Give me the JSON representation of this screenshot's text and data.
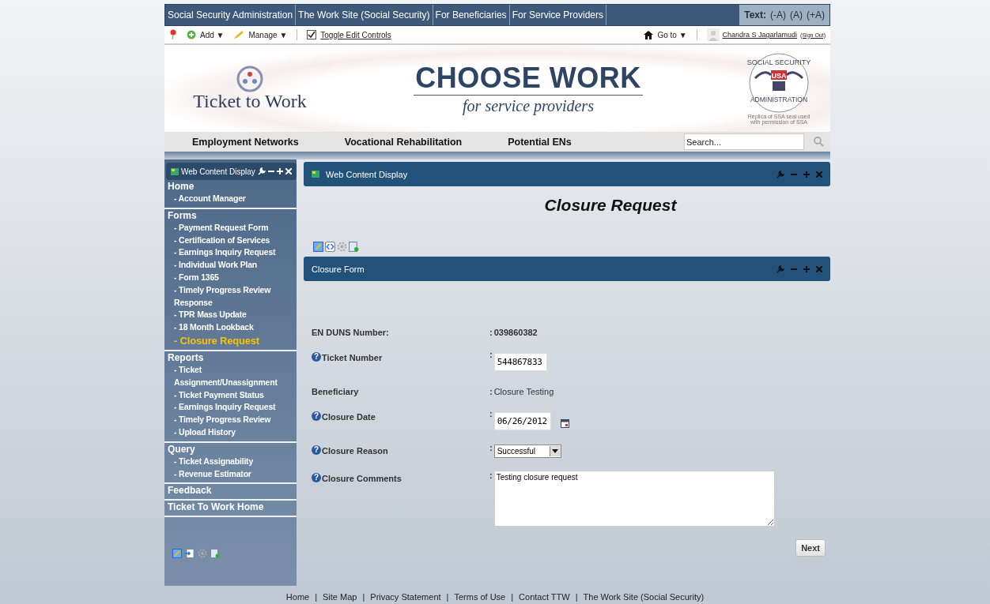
{
  "top_nav": {
    "links": [
      "Social Security Administration",
      "The Work Site (Social Security)",
      "For Beneficiaries",
      "For Service Providers"
    ],
    "text_size_label": "Text:",
    "text_sizes": [
      "(-A)",
      "(A)",
      "(+A)"
    ]
  },
  "toolbar": {
    "add": "Add",
    "add_caret": "▼",
    "manage": "Manage",
    "manage_caret": "▼",
    "goto_caret": "▼",
    "toggle": {
      "label": "Toggle Edit Controls",
      "checked": true
    },
    "goto": "Go to",
    "user": "Chandra S Jagarlamudi",
    "sign_out": "(Sign Out)"
  },
  "banner": {
    "logo_text": "Ticket to Work",
    "title": "CHOOSE WORK",
    "subtitle": "for service providers",
    "seal_top": "SOCIAL SECURITY",
    "seal_center": "USA",
    "seal_bottom": "ADMINISTRATION",
    "seal_caption": "Replica of SSA seal used with permission of SSA"
  },
  "main_nav": {
    "items": [
      "Employment Networks",
      "Vocational Rehabilitation",
      "Potential ENs"
    ],
    "search": {
      "placeholder": "Search..."
    }
  },
  "sidebar": {
    "portlet_title": "Web Content Display",
    "sections": [
      {
        "title": "Home",
        "items": [
          {
            "label": "- Account Manager",
            "selected": false
          }
        ]
      },
      {
        "title": "Forms",
        "items": [
          {
            "label": "- Payment Request Form",
            "selected": false
          },
          {
            "label": "- Certification of Services",
            "selected": false
          },
          {
            "label": "- Earnings Inquiry Request",
            "selected": false
          },
          {
            "label": "- Individual Work Plan",
            "selected": false
          },
          {
            "label": "- Form 1365",
            "selected": false
          },
          {
            "label": "- Timely Progress Review Response",
            "selected": false
          },
          {
            "label": "- TPR Mass Update",
            "selected": false
          },
          {
            "label": "- 18 Month Lookback",
            "selected": false
          },
          {
            "label": "- Closure Request",
            "selected": true
          }
        ]
      },
      {
        "title": "Reports",
        "items": [
          {
            "label": "- Ticket Assignment/Unassignment",
            "selected": false
          },
          {
            "label": "- Ticket Payment Status",
            "selected": false
          },
          {
            "label": "- Earnings Inquiry Request",
            "selected": false
          },
          {
            "label": "- Timely Progress Review",
            "selected": false
          },
          {
            "label": "- Upload History",
            "selected": false
          }
        ]
      },
      {
        "title": "Query",
        "items": [
          {
            "label": "- Ticket Assignability",
            "selected": false
          },
          {
            "label": "- Revenue Estimator",
            "selected": false
          }
        ]
      },
      {
        "title": "Feedback"
      },
      {
        "title": "Ticket To Work Home"
      }
    ]
  },
  "main": {
    "portlet_title": "Web Content Display",
    "heading": "Closure Request",
    "form_title": "Closure Form",
    "fields": [
      {
        "kind": "emphasized",
        "label": "EN DUNS Number:",
        "colon": ":",
        "value": "039860382"
      },
      {
        "kind": "input",
        "label": "Ticket Number",
        "help": "?",
        "colon": ":",
        "value": "544867833"
      },
      {
        "kind": "static",
        "label": "Beneficiary",
        "colon": ":",
        "value": "Closure Testing"
      },
      {
        "kind": "date",
        "label": "Closure Date",
        "help": "?",
        "colon": ":",
        "value": "06/26/2012"
      },
      {
        "kind": "select",
        "label": "Closure Reason",
        "help": "?",
        "colon": ":",
        "value": "Successful"
      },
      {
        "kind": "textarea",
        "label": "Closure Comments",
        "help": "?",
        "colon": ":",
        "value": "Testing closure request"
      }
    ],
    "next_button": "Next"
  },
  "footer": {
    "links": [
      "Home",
      "Site Map",
      "Privacy Statement",
      "Terms of Use",
      "Contact TTW",
      "The Work Site (Social Security)"
    ],
    "separator": "|"
  }
}
